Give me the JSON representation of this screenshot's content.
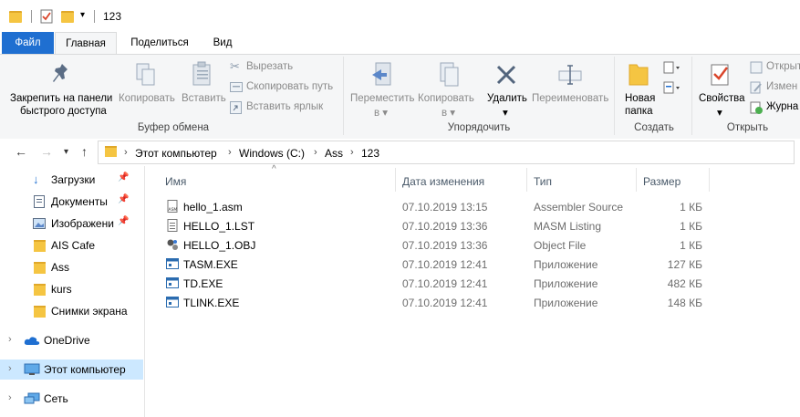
{
  "window": {
    "title": "123"
  },
  "ribbon_tabs": [
    "Файл",
    "Главная",
    "Поделиться",
    "Вид"
  ],
  "ribbon": {
    "clipboard": {
      "pin_label_1": "Закрепить на панели",
      "pin_label_2": "быстрого доступа",
      "copy": "Копировать",
      "paste": "Вставить",
      "cut": "Вырезать",
      "copy_path": "Скопировать путь",
      "paste_shortcut": "Вставить ярлык",
      "group": "Буфер обмена"
    },
    "organize": {
      "move_to_1": "Переместить",
      "move_to_2": "в",
      "copy_to_1": "Копировать",
      "copy_to_2": "в",
      "delete": "Удалить",
      "rename": "Переименовать",
      "group": "Упорядочить"
    },
    "create": {
      "new_folder_1": "Новая",
      "new_folder_2": "папка",
      "group": "Создать"
    },
    "open": {
      "properties": "Свойства",
      "open": "Открыт",
      "edit": "Измен",
      "history": "Журна",
      "group": "Открыть"
    }
  },
  "address": {
    "crumbs": [
      "Этот компьютер",
      "Windows (C:)",
      "Ass",
      "123"
    ]
  },
  "nav": {
    "items": [
      {
        "label": "Загрузки",
        "icon": "download-icon"
      },
      {
        "label": "Документы",
        "icon": "documents-icon"
      },
      {
        "label": "Изображени",
        "icon": "pictures-icon"
      },
      {
        "label": "AIS Cafe",
        "icon": "folder-icon"
      },
      {
        "label": "Ass",
        "icon": "folder-icon"
      },
      {
        "label": "kurs",
        "icon": "folder-icon"
      },
      {
        "label": "Снимки экрана",
        "icon": "folder-icon"
      },
      {
        "label": "OneDrive",
        "icon": "cloud-icon"
      },
      {
        "label": "Этот компьютер",
        "icon": "computer-icon"
      },
      {
        "label": "Сеть",
        "icon": "network-icon"
      }
    ]
  },
  "files": {
    "columns": [
      "Имя",
      "Дата изменения",
      "Тип",
      "Размер"
    ],
    "rows": [
      {
        "name": "hello_1.asm",
        "date": "07.10.2019 13:15",
        "type": "Assembler Source",
        "size": "1 КБ",
        "icon": "asm-file-icon"
      },
      {
        "name": "HELLO_1.LST",
        "date": "07.10.2019 13:36",
        "type": "MASM Listing",
        "size": "1 КБ",
        "icon": "text-file-icon"
      },
      {
        "name": "HELLO_1.OBJ",
        "date": "07.10.2019 13:36",
        "type": "Object File",
        "size": "1 КБ",
        "icon": "object-file-icon"
      },
      {
        "name": "TASM.EXE",
        "date": "07.10.2019 12:41",
        "type": "Приложение",
        "size": "127 КБ",
        "icon": "exe-icon"
      },
      {
        "name": "TD.EXE",
        "date": "07.10.2019 12:41",
        "type": "Приложение",
        "size": "482 КБ",
        "icon": "exe-icon"
      },
      {
        "name": "TLINK.EXE",
        "date": "07.10.2019 12:41",
        "type": "Приложение",
        "size": "148 КБ",
        "icon": "exe-icon"
      }
    ]
  },
  "colors": {
    "accent": "#1f6fd1",
    "folder": "#f5c542",
    "selected_nav": "#cce8ff"
  }
}
